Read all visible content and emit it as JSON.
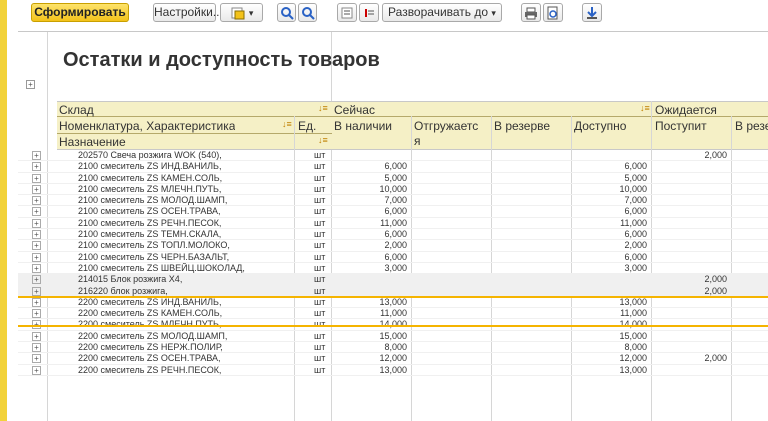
{
  "toolbar": {
    "generate": "Сформировать",
    "settings": "Настройки...",
    "expand_to": "Разворачивать до"
  },
  "report": {
    "title": "Остатки и доступность товаров",
    "headers": {
      "warehouse": "Склад",
      "item": "Номенклатура, Характеристика",
      "unit": "Ед.",
      "purpose": "Назначение",
      "now": "Сейчас",
      "in_stock": "В наличии",
      "shipping": "Отгружаетс я",
      "reserve": "В резерве",
      "available": "Доступно",
      "expected": "Ожидается",
      "incoming": "Поступит",
      "reserve2": "В резе"
    },
    "rows": [
      {
        "name": "202570 Свеча розжига WOK (540),",
        "unit": "шт",
        "in_stock": "",
        "available": "",
        "incoming": "2,000",
        "hl": false
      },
      {
        "name": "2100  смеситель ZS ИНД.ВАНИЛЬ,",
        "unit": "шт",
        "in_stock": "6,000",
        "available": "6,000",
        "incoming": "",
        "hl": false
      },
      {
        "name": "2100  смеситель ZS КАМЕН.СОЛЬ,",
        "unit": "шт",
        "in_stock": "5,000",
        "available": "5,000",
        "incoming": "",
        "hl": false
      },
      {
        "name": "2100  смеситель ZS МЛЕЧН.ПУТЬ,",
        "unit": "шт",
        "in_stock": "10,000",
        "available": "10,000",
        "incoming": "",
        "hl": false
      },
      {
        "name": "2100  смеситель ZS МОЛОД.ШАМП,",
        "unit": "шт",
        "in_stock": "7,000",
        "available": "7,000",
        "incoming": "",
        "hl": false
      },
      {
        "name": "2100  смеситель ZS ОСЕН.ТРАВА,",
        "unit": "шт",
        "in_stock": "6,000",
        "available": "6,000",
        "incoming": "",
        "hl": false
      },
      {
        "name": "2100  смеситель ZS РЕЧН.ПЕСОК,",
        "unit": "шт",
        "in_stock": "11,000",
        "available": "11,000",
        "incoming": "",
        "hl": false
      },
      {
        "name": "2100  смеситель ZS ТЕМН.СКАЛА,",
        "unit": "шт",
        "in_stock": "6,000",
        "available": "6,000",
        "incoming": "",
        "hl": false
      },
      {
        "name": "2100  смеситель ZS ТОПЛ.МОЛОКО,",
        "unit": "шт",
        "in_stock": "2,000",
        "available": "2,000",
        "incoming": "",
        "hl": false
      },
      {
        "name": "2100  смеситель ZS ЧЕРН.БАЗАЛЬТ,",
        "unit": "шт",
        "in_stock": "6,000",
        "available": "6,000",
        "incoming": "",
        "hl": false
      },
      {
        "name": "2100  смеситель ZS ШВЕЙЦ.ШОКОЛАД,",
        "unit": "шт",
        "in_stock": "3,000",
        "available": "3,000",
        "incoming": "",
        "hl": false
      },
      {
        "name": "214015 Блок розжига Х4,",
        "unit": "шт",
        "in_stock": "",
        "available": "",
        "incoming": "2,000",
        "hl": true
      },
      {
        "name": "216220 блок розжига,",
        "unit": "шт",
        "in_stock": "",
        "available": "",
        "incoming": "2,000",
        "hl": true
      },
      {
        "name": "2200  смеситель ZS ИНД.ВАНИЛЬ,",
        "unit": "шт",
        "in_stock": "13,000",
        "available": "13,000",
        "incoming": "",
        "hl": false
      },
      {
        "name": "2200  смеситель ZS КАМЕН.СОЛЬ,",
        "unit": "шт",
        "in_stock": "11,000",
        "available": "11,000",
        "incoming": "",
        "hl": false
      },
      {
        "name": "2200  смеситель ZS МЛЕЧН.ПУТЬ,",
        "unit": "шт",
        "in_stock": "14,000",
        "available": "14,000",
        "incoming": "",
        "hl": false
      },
      {
        "name": "2200  смеситель ZS МОЛОД.ШАМП,",
        "unit": "шт",
        "in_stock": "15,000",
        "available": "15,000",
        "incoming": "",
        "hl": false
      },
      {
        "name": "2200  смеситель ZS НЕРЖ.ПОЛИР,",
        "unit": "шт",
        "in_stock": "8,000",
        "available": "8,000",
        "incoming": "",
        "hl": false
      },
      {
        "name": "2200  смеситель ZS ОСЕН.ТРАВА,",
        "unit": "шт",
        "in_stock": "12,000",
        "available": "12,000",
        "incoming": "2,000",
        "hl": false
      },
      {
        "name": "2200  смеситель ZS РЕЧН.ПЕСОК,",
        "unit": "шт",
        "in_stock": "13,000",
        "available": "13,000",
        "incoming": "",
        "hl": false
      }
    ]
  },
  "colors": {
    "accent": "#f3c21a",
    "header_bg": "#f5f0c6",
    "selection": "#f5b400"
  }
}
